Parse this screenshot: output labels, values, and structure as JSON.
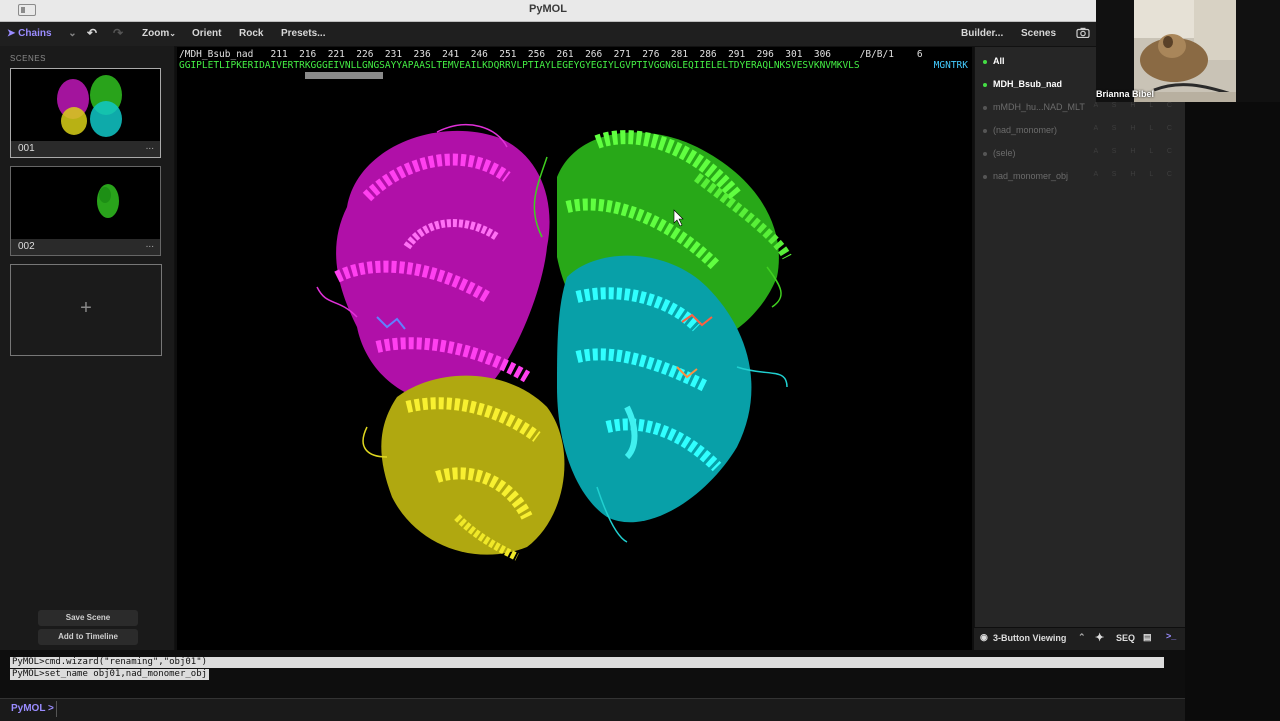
{
  "window": {
    "title": "PyMOL"
  },
  "toolbar": {
    "chains": "Chains",
    "zoom": "Zoom",
    "orient": "Orient",
    "rock": "Rock",
    "presets": "Presets...",
    "builder": "Builder...",
    "scenes": "Scenes"
  },
  "scenes_panel": {
    "heading": "SCENES",
    "cards": [
      {
        "number": "001"
      },
      {
        "number": "002"
      }
    ],
    "add_symbol": "+",
    "more": "...",
    "save_scene": "Save Scene",
    "add_to_timeline": "Add to Timeline"
  },
  "sequence": {
    "numbers": "/MDH_Bsub_nad   211  216  221  226  231  236  241  246  251  256  261  266  271  276  281  286  291  296  301  306     /B/B/1    6",
    "residues": "GGIPLETLIPKERIDAIVERTRKGGGEIVNLLGNGSAYYAPAASLTEMVEAILKDQRRVLPTIAYLEGEYGYEGIYLGVPTIVGGNGLEQIIELELTDYERAQLNKSVESVKNVMKVLS",
    "tail": "MGNTRK"
  },
  "objects": [
    {
      "name": "All",
      "enabled": true,
      "bold": true
    },
    {
      "name": "MDH_Bsub_nad",
      "enabled": true,
      "bold": true
    },
    {
      "name": "mMDH_hu...NAD_MLT",
      "enabled": false,
      "bold": false
    },
    {
      "name": "(nad_monomer)",
      "enabled": false,
      "bold": false
    },
    {
      "name": "(sele)",
      "enabled": false,
      "bold": false
    },
    {
      "name": "nad_monomer_obj",
      "enabled": false,
      "bold": false
    }
  ],
  "object_actions": "A S H L C",
  "status_bar": {
    "mode": "3-Button Viewing",
    "seq": "SEQ"
  },
  "command": {
    "history": [
      "PyMOL>cmd.wizard(\"renaming\",\"obj01\")",
      "PyMOL>set_name obj01,nad_monomer_obj"
    ],
    "prompt": "PyMOL >"
  },
  "video": {
    "participant": "Brianna Bibel"
  },
  "colors": {
    "accent": "#9a8cff",
    "chain_magenta": "#e020d0",
    "chain_green": "#40e020",
    "chain_cyan": "#10d8d8",
    "chain_yellow": "#e8e020",
    "enabled_dot": "#44dd44"
  }
}
